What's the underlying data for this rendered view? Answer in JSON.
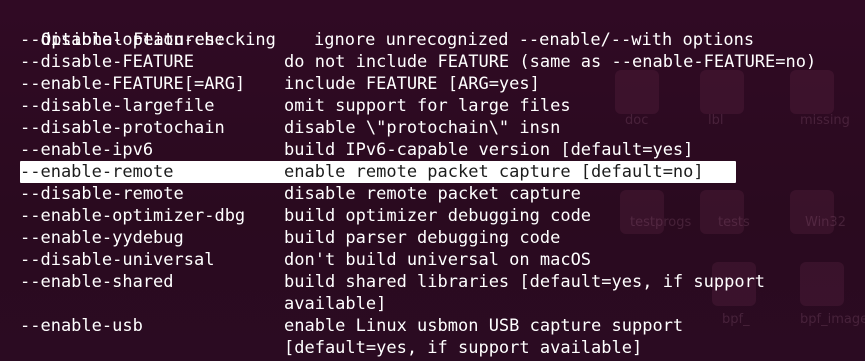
{
  "terminal": {
    "heading": "Optional Features:",
    "options": [
      {
        "flag": "--disable-option-checking",
        "desc": "ignore unrecognized --enable/--with options"
      },
      {
        "flag": "--disable-FEATURE",
        "desc": "do not include FEATURE (same as --enable-FEATURE=no)"
      },
      {
        "flag": "--enable-FEATURE[=ARG]",
        "desc": "include FEATURE [ARG=yes]"
      },
      {
        "flag": "--disable-largefile",
        "desc": "omit support for large files"
      },
      {
        "flag": "--disable-protochain",
        "desc": "disable \\\"protochain\\\" insn"
      },
      {
        "flag": "--enable-ipv6",
        "desc": "build IPv6-capable version [default=yes]"
      },
      {
        "flag": "--enable-remote",
        "desc": "enable remote packet capture [default=no]"
      },
      {
        "flag": "--disable-remote",
        "desc": "disable remote packet capture"
      },
      {
        "flag": "--enable-optimizer-dbg",
        "desc": "build optimizer debugging code"
      },
      {
        "flag": "--enable-yydebug",
        "desc": "build parser debugging code"
      },
      {
        "flag": "--disable-universal",
        "desc": "don't build universal on macOS"
      },
      {
        "flag": "--enable-shared",
        "desc": "build shared libraries [default=yes, if support",
        "desc_cont": "available]"
      },
      {
        "flag": "--enable-usb",
        "desc": "enable Linux usbmon USB capture support",
        "desc_cont": "[default=yes, if support available]"
      }
    ]
  },
  "background": {
    "labels": [
      "doc",
      "lbl",
      "missing",
      "testprogs",
      "tests",
      "Win32",
      "bpf_",
      "bpf_image"
    ],
    "colors": {
      "terminal_bg": "#300a24",
      "text": "#ffffff",
      "highlight_bg": "#ffffff",
      "highlight_text": "#1c1c1c"
    }
  }
}
